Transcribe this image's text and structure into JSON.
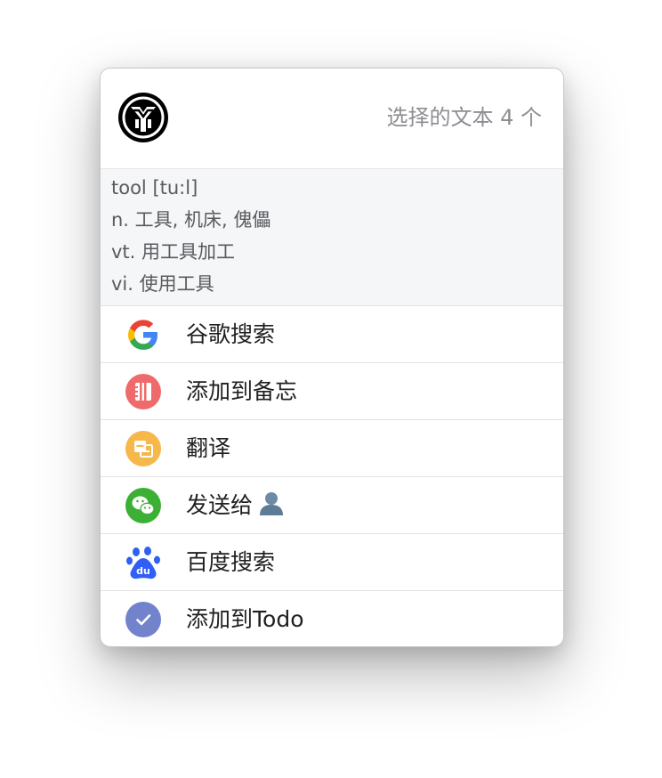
{
  "header": {
    "selection_text": "选择的文本 4 个",
    "logo_icon": "yu-logo-icon"
  },
  "dictionary": {
    "lines": [
      "tool [tu:l]",
      "n. 工具, 机床, 傀儡",
      "vt. 用工具加工",
      "vi. 使用工具"
    ]
  },
  "menu": {
    "items": [
      {
        "label": "谷歌搜索",
        "icon": "google-icon"
      },
      {
        "label": "添加到备忘",
        "icon": "memo-icon",
        "color": "#ef6a6a"
      },
      {
        "label": "翻译",
        "icon": "translate-icon",
        "color": "#f7b84b"
      },
      {
        "label": "发送给",
        "icon": "wechat-icon",
        "color": "#3cb034"
      },
      {
        "label": "百度搜索",
        "icon": "baidu-icon",
        "color": "#2f5ff5"
      },
      {
        "label": "添加到Todo",
        "icon": "todo-check-icon",
        "color": "#7283cc"
      }
    ]
  }
}
